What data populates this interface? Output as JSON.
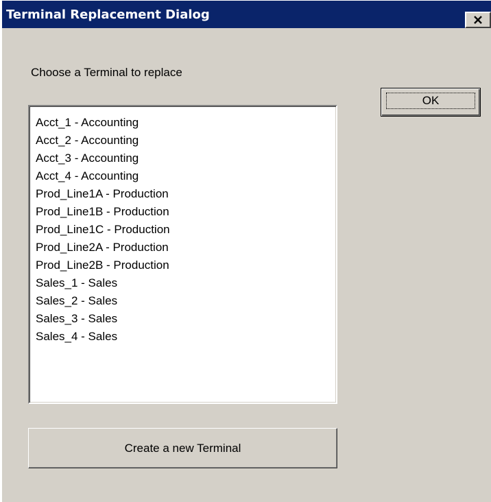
{
  "window": {
    "title": "Terminal Replacement Dialog",
    "close_icon": "close-icon",
    "colors": {
      "titlebar": "#0a246a",
      "face": "#d4d0c8",
      "list_bg": "#ffffff"
    }
  },
  "prompt": "Choose a Terminal to replace",
  "ok_label": "OK",
  "terminals": [
    "Acct_1 - Accounting",
    "Acct_2 - Accounting",
    "Acct_3 - Accounting",
    "Acct_4 - Accounting",
    "Prod_Line1A - Production",
    "Prod_Line1B - Production",
    "Prod_Line1C - Production",
    "Prod_Line2A - Production",
    "Prod_Line2B - Production",
    "Sales_1 - Sales",
    "Sales_2 - Sales",
    "Sales_3 - Sales",
    "Sales_4 - Sales"
  ],
  "create_label": "Create a new Terminal"
}
